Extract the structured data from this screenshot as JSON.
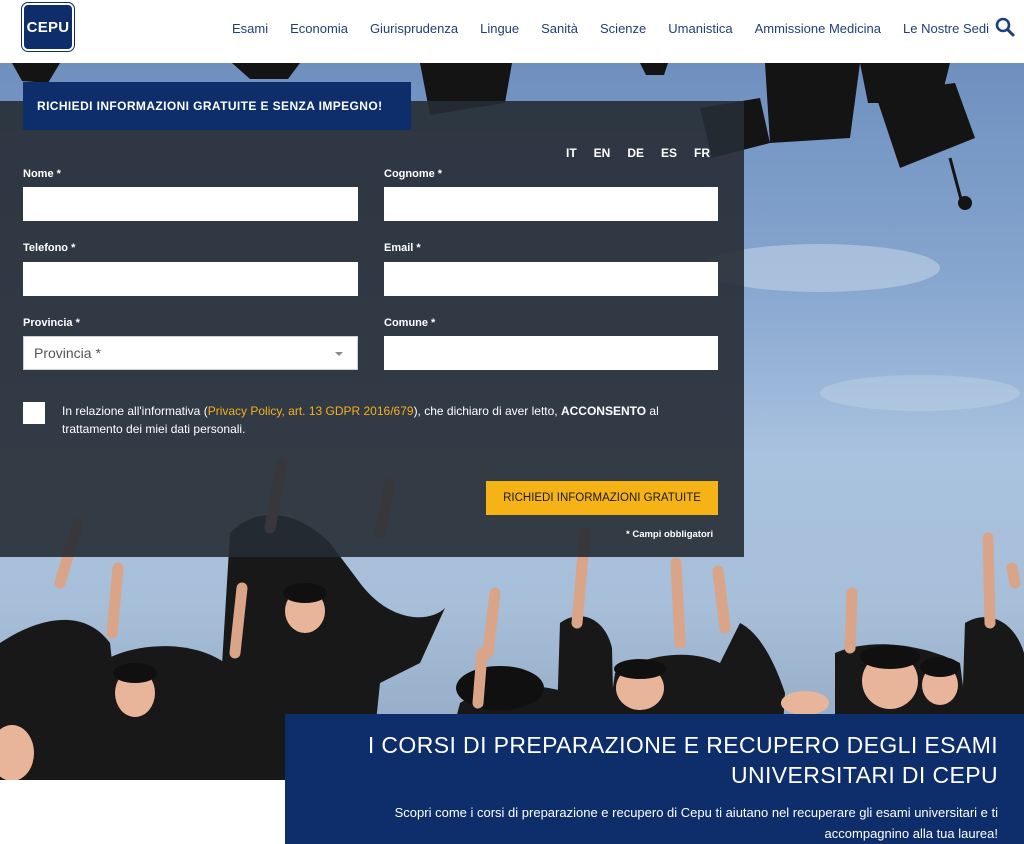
{
  "brand": {
    "logo_text": "CEPU"
  },
  "nav": {
    "items": [
      "Esami",
      "Economia",
      "Giurisprudenza",
      "Lingue",
      "Sanità",
      "Scienze",
      "Umanistica",
      "Ammissione Medicina",
      "Le Nostre Sedi"
    ],
    "search_icon": "search-icon"
  },
  "form": {
    "tab_title": "RICHIEDI INFORMAZIONI GRATUITE E SENZA IMPEGNO!",
    "languages": [
      "IT",
      "EN",
      "DE",
      "ES",
      "FR"
    ],
    "fields": {
      "nome": {
        "label": "Nome *",
        "value": ""
      },
      "cognome": {
        "label": "Cognome *",
        "value": ""
      },
      "telefono": {
        "label": "Telefono *",
        "value": ""
      },
      "email": {
        "label": "Email *",
        "value": ""
      },
      "provincia": {
        "label": "Provincia *",
        "selected": "Provincia *"
      },
      "comune": {
        "label": "Comune *",
        "value": ""
      }
    },
    "consent": {
      "prefix": "In relazione all'informativa (",
      "link": "Privacy Policy, art. 13 GDPR 2016/679",
      "middle": "), che dichiaro di aver letto, ",
      "bold": "ACCONSENTO",
      "suffix": " al trattamento dei miei dati personali.",
      "checked": false
    },
    "submit_label": "RICHIEDI INFORMAZIONI GRATUITE",
    "required_note": "* Campi obbligatori"
  },
  "banner": {
    "title": "I CORSI DI PREPARAZIONE E RECUPERO DEGLI ESAMI UNIVERSITARI DI CEPU",
    "subtitle": "Scopri come i corsi di preparazione e recupero di Cepu ti aiutano nel recuperare gli esami universitari e ti accompagnino alla tua laurea!"
  },
  "colors": {
    "brand_navy": "#0d2d6b",
    "accent_yellow": "#f6b316",
    "link_yellow": "#f4b01c",
    "panel_overlay": "#262c34",
    "nav_text": "#1f3f7a"
  }
}
